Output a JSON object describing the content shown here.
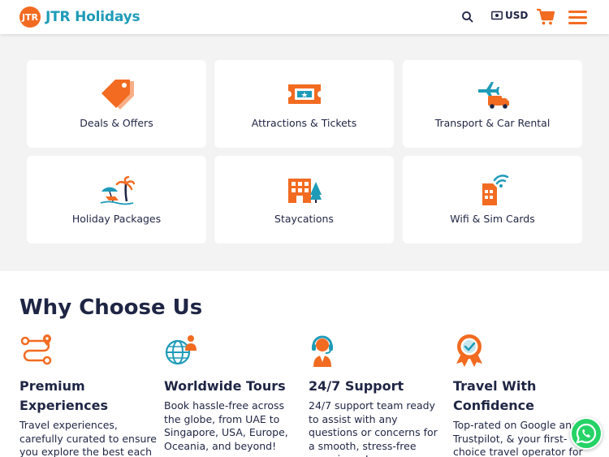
{
  "brand": {
    "logo_mark": "JTR",
    "name": "JTR Holidays"
  },
  "header": {
    "currency": "USD",
    "icons": [
      "search-icon",
      "currency-icon",
      "cart-icon",
      "hamburger-menu-icon"
    ]
  },
  "colors": {
    "accent": "#f26b21",
    "brand_teal": "#1f9bb8",
    "text_dark": "#1f2544",
    "whatsapp": "#25d366"
  },
  "categories": [
    {
      "label": "Deals & Offers",
      "icon": "price-tag-icon"
    },
    {
      "label": "Attractions & Tickets",
      "icon": "ticket-icon"
    },
    {
      "label": "Transport & Car Rental",
      "icon": "plane-truck-icon"
    },
    {
      "label": "Holiday Packages",
      "icon": "beach-icon"
    },
    {
      "label": "Staycations",
      "icon": "hotel-icon"
    },
    {
      "label": "Wifi & Sim Cards",
      "icon": "sim-wifi-icon"
    }
  ],
  "why": {
    "title": "Why Choose Us",
    "features": [
      {
        "title": "Premium Experiences",
        "desc": "Travel experiences, carefully curated to ensure you explore the best each destination has to offer.",
        "icon": "route-icon"
      },
      {
        "title": "Worldwide Tours",
        "desc": "Book hassle-free across the globe, from UAE to Singapore, USA, Europe, Oceania, and beyond!",
        "icon": "globe-person-icon"
      },
      {
        "title": "24/7 Support",
        "desc": "24/7 support team ready to assist with any questions or concerns for a smooth, stress-free experience!",
        "icon": "support-agent-icon"
      },
      {
        "title": "Travel With Confidence",
        "desc": "Top-rated on Google and Trustpilot, & your first-choice travel operator for a",
        "icon": "award-badge-icon"
      }
    ]
  },
  "whatsapp_icon": "whatsapp-icon"
}
